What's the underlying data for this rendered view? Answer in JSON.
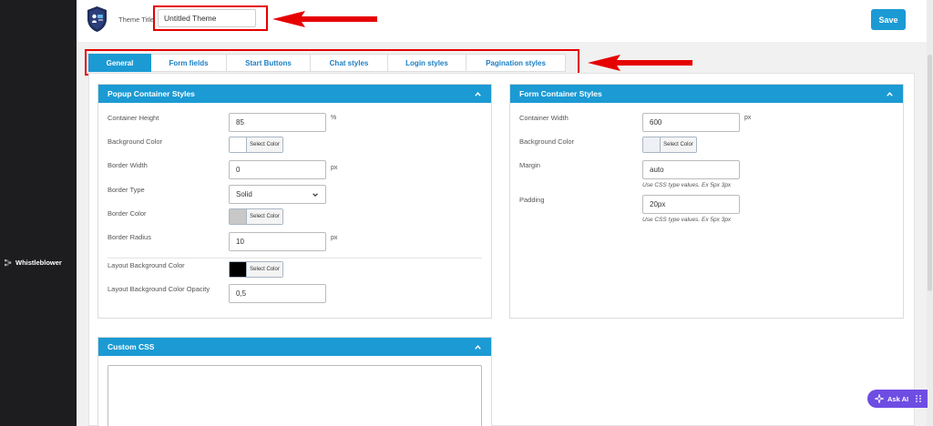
{
  "sidebar": {
    "item_label": "Whistleblower"
  },
  "header": {
    "theme_title_label": "Theme Title",
    "theme_title_value": "Untitled Theme",
    "save_label": "Save"
  },
  "tabs": [
    {
      "label": "General",
      "active": true
    },
    {
      "label": "Form fields",
      "active": false
    },
    {
      "label": "Start Buttons",
      "active": false
    },
    {
      "label": "Chat styles",
      "active": false
    },
    {
      "label": "Login styles",
      "active": false
    },
    {
      "label": "Pagination styles",
      "active": false
    }
  ],
  "popup": {
    "title": "Popup Container Styles",
    "container_height_label": "Container Height",
    "container_height_value": "85",
    "container_height_unit": "%",
    "background_color_label": "Background Color",
    "background_color_value": "#ffffff",
    "border_width_label": "Border Width",
    "border_width_value": "0",
    "border_width_unit": "px",
    "border_type_label": "Border Type",
    "border_type_value": "Solid",
    "border_color_label": "Border Color",
    "border_color_value": "#c8c8c8",
    "border_radius_label": "Border Radius",
    "border_radius_value": "10",
    "border_radius_unit": "px",
    "layout_bg_label": "Layout Background Color",
    "layout_bg_value": "#000000",
    "layout_opacity_label": "Layout Background Color Opacity",
    "layout_opacity_value": "0,5"
  },
  "form": {
    "title": "Form Container Styles",
    "container_width_label": "Container Width",
    "container_width_value": "600",
    "container_width_unit": "px",
    "background_color_label": "Background Color",
    "background_color_value": "#eef0f5",
    "margin_label": "Margin",
    "margin_value": "auto",
    "margin_hint": "Use CSS type values. Ex 5px 3px",
    "padding_label": "Padding",
    "padding_value": "20px",
    "padding_hint": "Use CSS type values. Ex 5px 3px"
  },
  "custom_css": {
    "title": "Custom CSS"
  },
  "select_color_label": "Select Color",
  "ask_ai_label": "Ask AI",
  "colors": {
    "accent": "#1b9ad4",
    "annotation": "#e60000",
    "ask_ai": "#6e4de3"
  }
}
